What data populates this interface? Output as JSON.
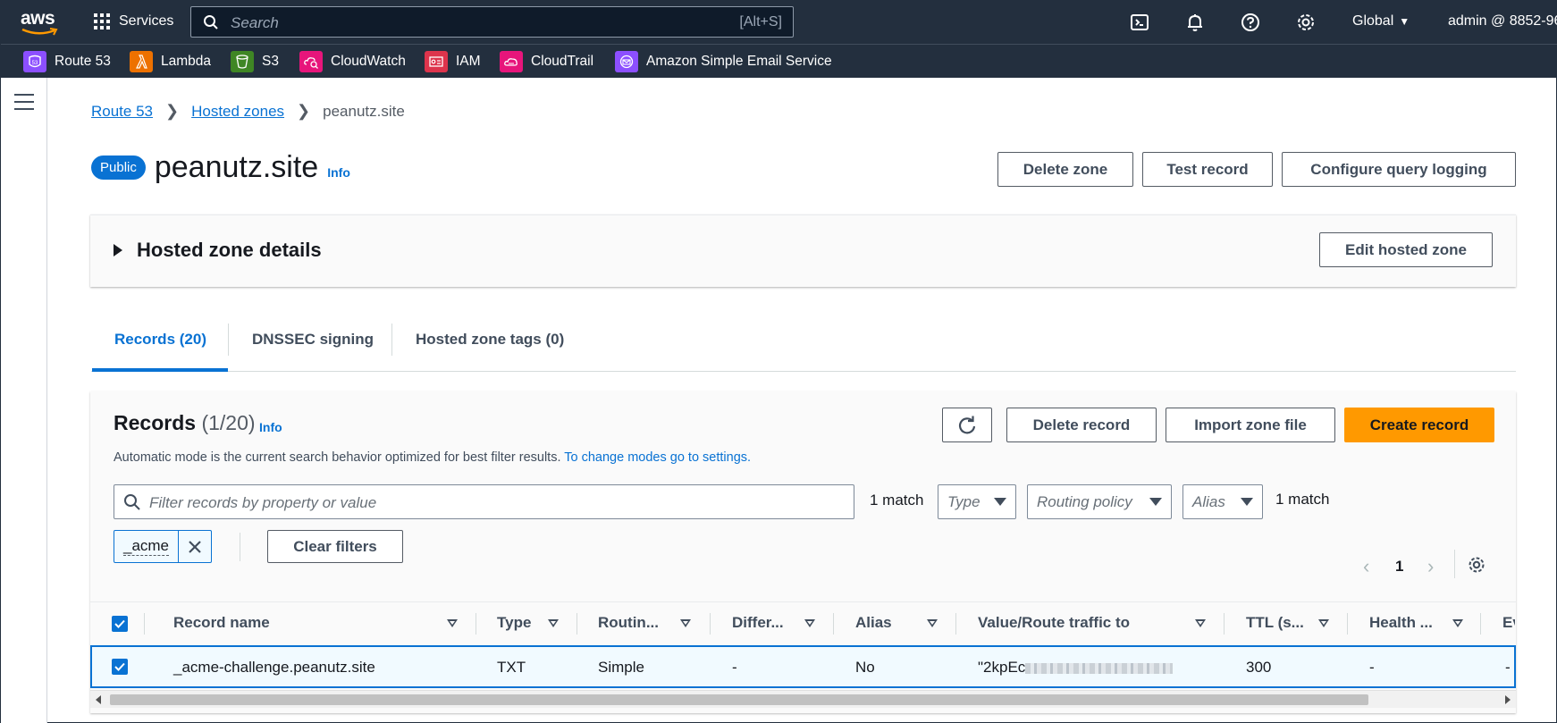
{
  "topbar": {
    "logo": "aws",
    "services_label": "Services",
    "search_placeholder": "Search",
    "search_shortcut": "[Alt+S]",
    "region": "Global",
    "account": "admin @ 8852-96"
  },
  "favorites": [
    {
      "label": "Route 53",
      "color": "#8c4fff"
    },
    {
      "label": "Lambda",
      "color": "#ed7100"
    },
    {
      "label": "S3",
      "color": "#3f8624"
    },
    {
      "label": "CloudWatch",
      "color": "#e7157b"
    },
    {
      "label": "IAM",
      "color": "#dd344c"
    },
    {
      "label": "CloudTrail",
      "color": "#e7157b"
    },
    {
      "label": "Amazon Simple Email Service",
      "color": "#8c4fff"
    }
  ],
  "breadcrumb": {
    "items": [
      "Route 53",
      "Hosted zones"
    ],
    "current": "peanutz.site"
  },
  "header": {
    "badge": "Public",
    "title": "peanutz.site",
    "info": "Info",
    "buttons": {
      "delete_zone": "Delete zone",
      "test_record": "Test record",
      "configure_logging": "Configure query logging"
    }
  },
  "details_panel": {
    "title": "Hosted zone details",
    "edit_button": "Edit hosted zone"
  },
  "tabs": [
    {
      "label": "Records (20)",
      "active": true
    },
    {
      "label": "DNSSEC signing",
      "active": false
    },
    {
      "label": "Hosted zone tags (0)",
      "active": false
    }
  ],
  "records": {
    "title": "Records",
    "count": "(1/20)",
    "info": "Info",
    "description": "Automatic mode is the current search behavior optimized for best filter results.",
    "description_link": "To change modes go to settings.",
    "buttons": {
      "delete": "Delete record",
      "import": "Import zone file",
      "create": "Create record"
    },
    "filter_placeholder": "Filter records by property or value",
    "match_text": "1 match",
    "dropdowns": {
      "type": "Type",
      "routing": "Routing policy",
      "alias": "Alias"
    },
    "match_text_2": "1 match",
    "token": "_acme",
    "clear_filters": "Clear filters",
    "page": "1",
    "columns": [
      "Record name",
      "Type",
      "Routin...",
      "Differ...",
      "Alias",
      "Value/Route traffic to",
      "TTL (s...",
      "Health ...",
      "Ev"
    ],
    "rows": [
      {
        "name": "_acme-challenge.peanutz.site",
        "type": "TXT",
        "routing": "Simple",
        "differ": "-",
        "alias": "No",
        "value": "\"2kpEc",
        "ttl": "300",
        "health": "-",
        "ev": "-"
      }
    ]
  }
}
